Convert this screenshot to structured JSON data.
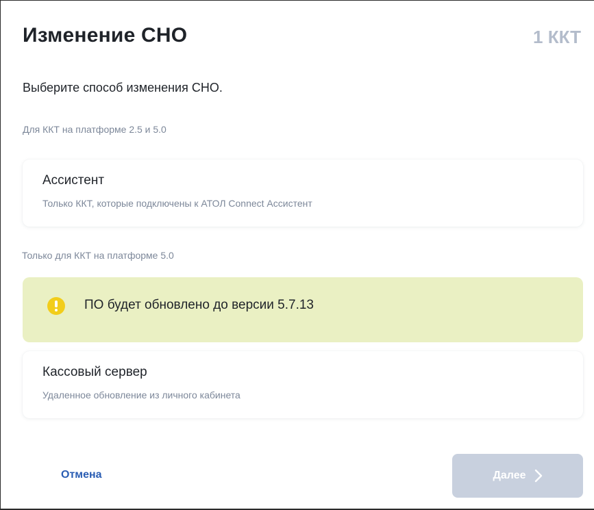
{
  "dialog": {
    "title": "Изменение СНО",
    "count": "1 ККТ",
    "subtitle": "Выберите способ изменения СНО."
  },
  "sections": [
    {
      "label": "Для ККТ на платформе 2.5 и 5.0",
      "option": {
        "title": "Ассистент",
        "description": "Только ККТ, которые подключены к АТОЛ Connect Ассистент"
      }
    },
    {
      "label": "Только для ККТ на платформе 5.0",
      "warning": {
        "icon": "exclamation-circle-icon",
        "text": "ПО будет обновлено до версии 5.7.13",
        "color": "#eaf0c3",
        "icon_color": "#f2cd1b"
      },
      "option": {
        "title": "Кассовый сервер",
        "description": "Удаленное обновление из личного кабинета"
      }
    }
  ],
  "footer": {
    "cancel_label": "Отмена",
    "next_label": "Далее",
    "next_icon": "chevron-right-icon",
    "next_disabled": true
  },
  "colors": {
    "accent": "#2a5db3",
    "muted": "#7c8799",
    "count": "#b3bccb",
    "button_disabled": "#c8d0de"
  }
}
